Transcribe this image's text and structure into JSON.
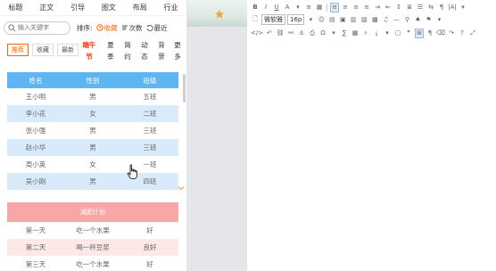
{
  "nav": {
    "tabs": [
      "标题",
      "正文",
      "引导",
      "图文",
      "布局",
      "行业"
    ]
  },
  "search": {
    "placeholder": "输入关键字"
  },
  "sort": {
    "label": "排序:",
    "options": [
      {
        "label": "收藏",
        "active": true
      },
      {
        "label": "次数",
        "active": false
      },
      {
        "label": "最近",
        "active": false
      }
    ]
  },
  "filters": {
    "buttons": [
      {
        "label": "推荐",
        "active": true
      },
      {
        "label": "收藏",
        "active": false
      },
      {
        "label": "最新",
        "active": false
      }
    ],
    "categories": [
      {
        "top": "端午",
        "bottom": "节",
        "hot": true
      },
      {
        "top": "夏",
        "bottom": "季",
        "hot": false
      },
      {
        "top": "简",
        "bottom": "约",
        "hot": false
      },
      {
        "top": "动",
        "bottom": "态",
        "hot": false
      },
      {
        "top": "背",
        "bottom": "景",
        "hot": false
      },
      {
        "top": "更",
        "bottom": "多",
        "hot": false
      }
    ]
  },
  "table1": {
    "headers": [
      "姓名",
      "性别",
      "班级"
    ],
    "rows": [
      [
        "王小明",
        "男",
        "五班"
      ],
      [
        "李小花",
        "女",
        "二班"
      ],
      [
        "张小强",
        "男",
        "三班"
      ],
      [
        "赵小华",
        "男",
        "三班"
      ],
      [
        "周小英",
        "女",
        "一班"
      ],
      [
        "吴小刚",
        "男",
        "四班"
      ]
    ]
  },
  "table2": {
    "title": "减肥计划",
    "rows": [
      [
        "第一天",
        "吃一个水果",
        "好"
      ],
      [
        "第二天",
        "喝一杯豆浆",
        "良好"
      ],
      [
        "第三天",
        "吃一个水果",
        "好"
      ]
    ]
  },
  "editor": {
    "font_name": "微软雅",
    "font_size": "16p"
  },
  "colors": {
    "accent": "#ff6600",
    "table1_header": "#5eb5f4",
    "table1_alt": "#d9ebfb",
    "table2_header": "#f9a6a6",
    "table2_alt": "#fde8e8"
  }
}
